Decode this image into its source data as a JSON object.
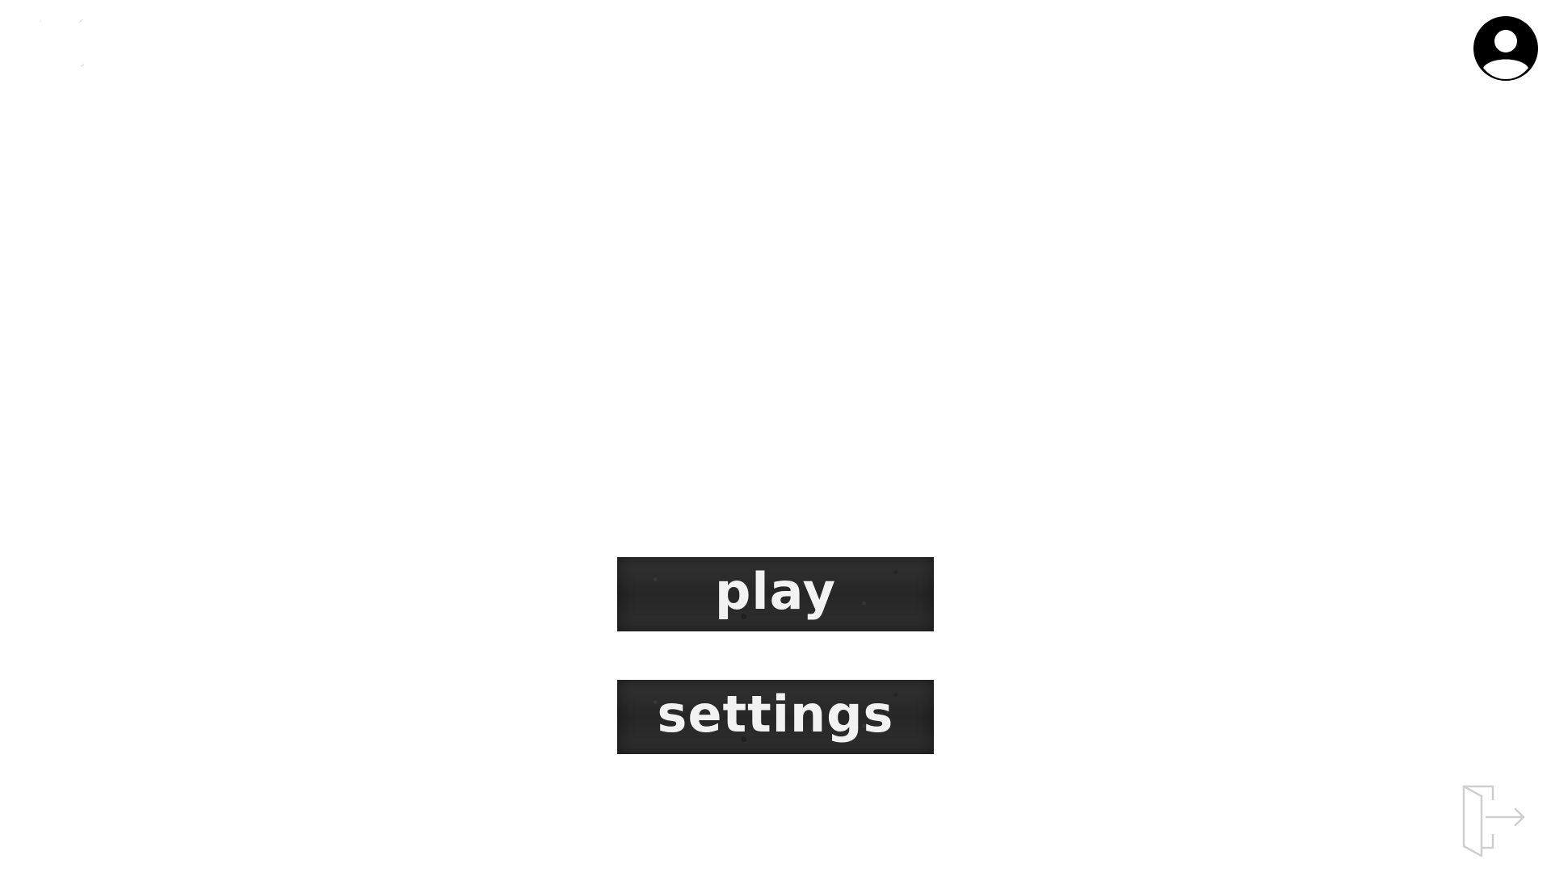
{
  "menu": {
    "play_label": "play",
    "settings_label": "settings"
  },
  "icons": {
    "profile": "user-avatar-icon",
    "exit": "exit-door-icon"
  },
  "colors": {
    "background": "#ffffff",
    "button_fill": "#2b2b2b",
    "button_text": "#f2f2f2",
    "profile_icon": "#000000",
    "exit_icon_outline": "#cfcfcf"
  }
}
